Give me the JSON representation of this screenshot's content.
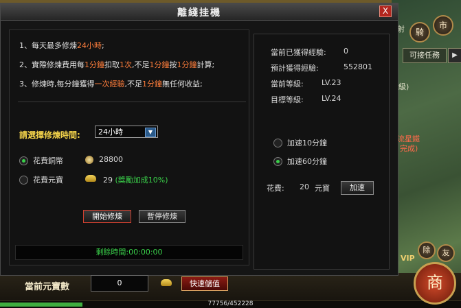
{
  "dialog": {
    "title": "離綫挂機",
    "close_label": "X"
  },
  "rules": [
    {
      "p1": "1、每天最多修煉",
      "h1": "24小時",
      "p2": ";",
      "h2": "",
      "p3": "",
      "h3": "",
      "p4": "",
      "h4": "",
      "p5": ""
    },
    {
      "p1": "2、實際修煉費用每",
      "h1": "1分鐘",
      "p2": "扣取",
      "h2": "1次",
      "p3": ",不足",
      "h3": "1分鐘",
      "p4": "按",
      "h4": "1分鐘",
      "p5": "計算;"
    },
    {
      "p1": "3、修煉時,每分鐘獲得",
      "h1": "一次經驗",
      "p2": ",不足",
      "h2": "1分鐘",
      "p3": "無任何收益;",
      "h3": "",
      "p4": "",
      "h4": "",
      "p5": ""
    }
  ],
  "duration": {
    "label": "請選擇修煉時間:",
    "selected": "24小時"
  },
  "payment": {
    "copper_label": "花費銅幣",
    "copper_value": "28800",
    "copper_selected": true,
    "gold_label": "花費元寶",
    "gold_value": "29",
    "gold_bonus": "(獎勵加成10%)",
    "gold_selected": false
  },
  "buttons": {
    "start": "開始修煉",
    "pause": "暫停修煉",
    "speedup": "加速",
    "recharge": "快速儲值"
  },
  "remaining": "剩餘時間:00:00:00",
  "info": {
    "gained_label": "當前已獲得經驗:",
    "gained_value": "0",
    "expected_label": "預計獲得經驗:",
    "expected_value": "552801",
    "current_level_label": "當前等級:",
    "current_level_value": "LV.23",
    "target_level_label": "目標等級:",
    "target_level_value": "LV.24"
  },
  "speed": {
    "opt10": "加速10分鐘",
    "opt10_selected": false,
    "opt60": "加速60分鐘",
    "opt60_selected": true,
    "cost_label": "花費:",
    "cost_value": "20",
    "cost_unit": "元寶"
  },
  "bottom": {
    "label": "當前元寶數",
    "value": "0"
  },
  "hud": {
    "quest_button": "可接任務",
    "city_buttons": [
      "騎",
      "市"
    ],
    "side_labels": [
      "除",
      "友"
    ],
    "vip": "VIP",
    "shop": "商",
    "exp_text": "77756/452228",
    "side_fragments": [
      "射",
      "級)",
      "流星鐵",
      "完成)"
    ]
  },
  "colors": {
    "highlight": "#ff7e3c",
    "green": "#3ad04a",
    "yellow_label": "#f2d24a",
    "close_red": "#b3261e"
  }
}
